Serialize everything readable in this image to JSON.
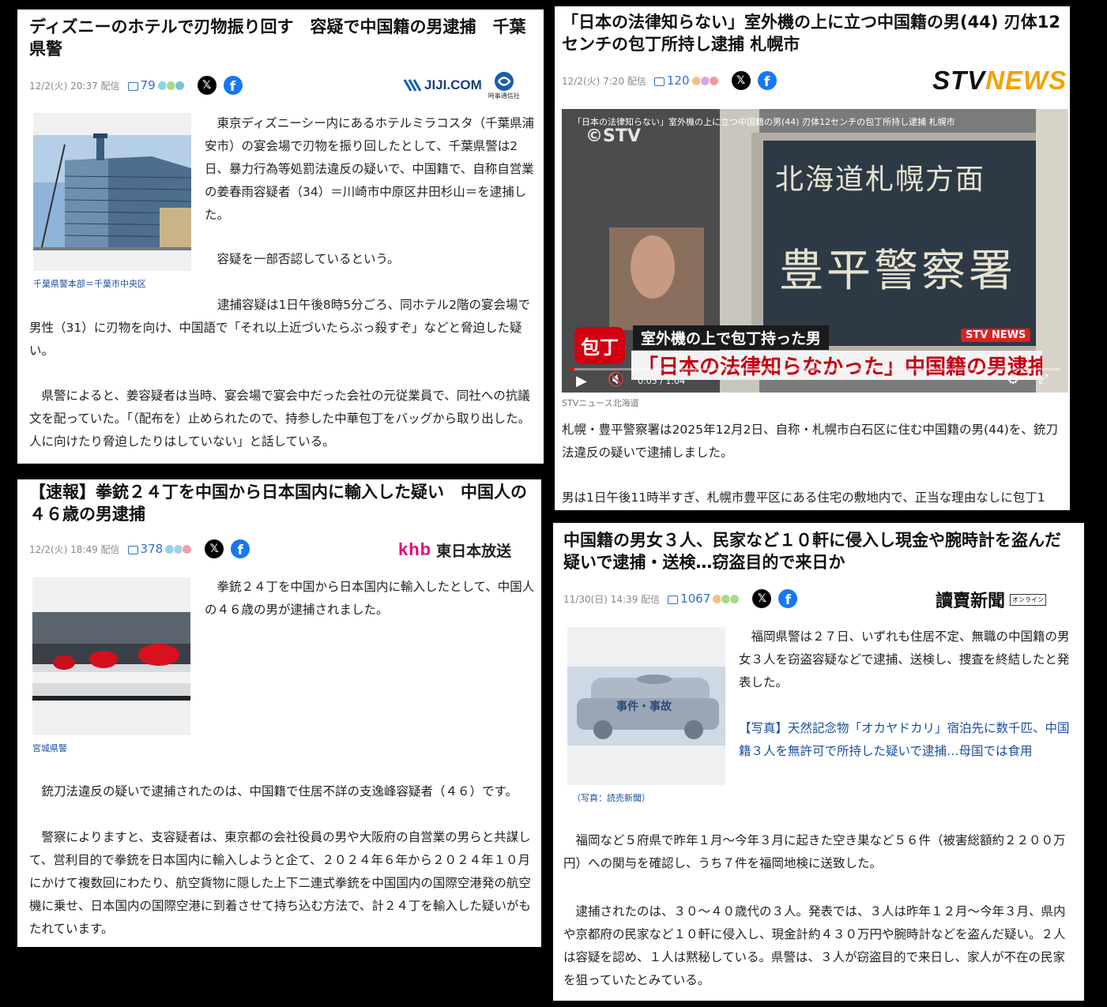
{
  "articles": [
    {
      "title": "ディズニーのホテルで刃物振り回す　容疑で中国籍の男逮捕　千葉県警",
      "date": "12/2(火) 20:37 配信",
      "comments": "79",
      "source": "JIJI.COM",
      "source_sub": "時事通信社",
      "caption": "千葉県警本部＝千葉市中央区",
      "paragraphs": [
        "東京ディズニーシー内にあるホテルミラコスタ（千葉県浦安市）の宴会場で刃物を振り回したとして、千葉県警は2日、暴力行為等処罰法違反の疑いで、中国籍で、自称自営業の姜春雨容疑者（34）＝川崎市中原区井田杉山＝を逮捕した。",
        "容疑を一部否認しているという。",
        "逮捕容疑は1日午後8時5分ごろ、同ホテル2階の宴会場で男性（31）に刃物を向け、中国語で「それ以上近づいたらぶっ殺すぞ」などと脅迫した疑い。",
        "県警によると、姜容疑者は当時、宴会場で宴会中だった会社の元従業員で、同社への抗議文を配っていた。「（配布を）止められたので、持参した中華包丁をバッグから取り出した。人に向けたり脅迫したりはしていない」と話している。"
      ]
    },
    {
      "title": "「日本の法律知らない」室外機の上に立つ中国籍の男(44) 刃体12センチの包丁所持し逮捕 札幌市",
      "date": "12/2(火) 7:20 配信",
      "comments": "120",
      "source": "STV NEWS",
      "video_title": "「日本の法律知らない」室外機の上に立つ中国籍の男(44) 刃体12センチの包丁所持し逮捕 札幌市",
      "video_watermark": "©STV",
      "video_sign_1": "北海道札幌方面",
      "video_sign_2": "豊平警察署",
      "video_tag": "包丁",
      "video_sub_1": "室外機の上で包丁持った男",
      "video_sub_2": "「日本の法律知らなかった」中国籍の男逮捕",
      "video_badge": "STV NEWS",
      "video_time": "0:05 / 1:04",
      "credit": "STVニュース北海道",
      "paragraphs": [
        "札幌・豊平警察署は2025年12月2日、自称・札幌市白石区に住む中国籍の男(44)を、銃刀法違反の疑いで逮捕しました。",
        "男は1日午後11時半すぎ、札幌市豊平区にある住宅の敷地内で、正当な理由なしに包丁1"
      ]
    },
    {
      "title": "【速報】拳銃２４丁を中国から日本国内に輸入した疑い　中国人の４６歳の男逮捕",
      "date": "12/2(火) 18:49 配信",
      "comments": "378",
      "source": "khb",
      "source_sub": "東日本放送",
      "caption": "宮城県警",
      "paragraphs": [
        "拳銃２４丁を中国から日本国内に輸入したとして、中国人の４６歳の男が逮捕されました。",
        "銃刀法違反の疑いで逮捕されたのは、中国籍で住居不詳の支逸峰容疑者（４６）です。",
        "警察によりますと、支容疑者は、東京都の会社役員の男や大阪府の自営業の男らと共謀して、営利目的で拳銃を日本国内に輸入しようと企て、２０２４年６年から２０２４年１０月にかけて複数回にわたり、航空貨物に隠した上下二連式拳銃を中国国内の国際空港発の航空機に乗せ、日本国内の国際空港に到着させて持ち込む方法で、計２４丁を輸入した疑いがもたれています。"
      ]
    },
    {
      "title": "中国籍の男女３人、民家など１０軒に侵入し現金や腕時計を盗んだ疑いで逮捕・送検…窃盗目的で来日か",
      "date": "11/30(日) 14:39 配信",
      "comments": "1067",
      "source": "讀賣新聞",
      "source_sub": "オンライン",
      "image_label": "事件・事故",
      "caption": "（写真：読売新聞）",
      "link": "【写真】天然記念物「オカヤドカリ」宿泊先に数千匹、中国籍３人を無許可で所持した疑いで逮捕…母国では食用",
      "paragraphs": [
        "福岡県警は２７日、いずれも住居不定、無職の中国籍の男女３人を窃盗容疑などで逮捕、送検し、捜査を終結したと発表した。",
        "福岡など５府県で昨年１月～今年３月に起きた空き巣など５６件（被害総額約２２００万円）への関与を確認し、うち７件を福岡地検に送致した。",
        "逮捕されたのは、３０～４０歳代の３人。発表では、３人は昨年１２月～今年３月、県内や京都府の民家など１０軒に侵入し、現金計約４３０万円や腕時計などを盗んだ疑い。２人は容疑を認め、１人は黙秘している。県警は、３人が窃盗目的で来日し、家人が不在の民家を狙っていたとみている。"
      ]
    }
  ],
  "icons": {
    "x": "x-logo-icon",
    "facebook": "facebook-icon",
    "comment": "comment-bubble-icon"
  },
  "colors": {
    "link": "#1a4fa3",
    "comment": "#2f6fc9",
    "stv_orange": "#f5a000",
    "khb_pink": "#e6007e",
    "facebook": "#1877f2"
  }
}
